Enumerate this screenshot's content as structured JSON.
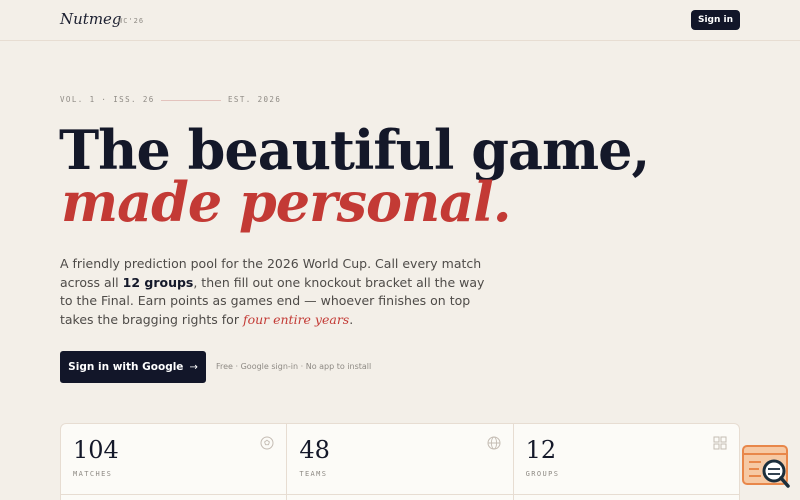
{
  "header": {
    "brand": "Nutmeg",
    "brand_tag": "WC'26",
    "signin_label": "Sign in"
  },
  "issue": {
    "volume": "VOL. 1 · ISS. 26",
    "established": "EST. 2026"
  },
  "hero": {
    "headline_line1": "The beautiful game,",
    "headline_line2": "made personal.",
    "intro_a": "A friendly prediction pool for the 2026 World Cup. Call every match across all ",
    "intro_bold": "12 groups",
    "intro_b": ", then fill out one knockout bracket all the way to the Final. Earn points as games end — whoever finishes on top takes the bragging rights for ",
    "intro_italic": "four entire years",
    "intro_end": "."
  },
  "cta": {
    "google_label": "Sign in with Google",
    "arrow": "→",
    "note": "Free · Google sign-in · No app to install"
  },
  "stats": [
    {
      "value": "104",
      "label": "MATCHES",
      "icon": "ball-icon"
    },
    {
      "value": "48",
      "label": "TEAMS",
      "icon": "globe-icon"
    },
    {
      "value": "12",
      "label": "GROUPS",
      "icon": "grid-icon"
    }
  ],
  "colors": {
    "background": "#f3efe8",
    "ink": "#141829",
    "accent": "#c33a35",
    "button": "#121629",
    "muted": "#8e8a84"
  }
}
